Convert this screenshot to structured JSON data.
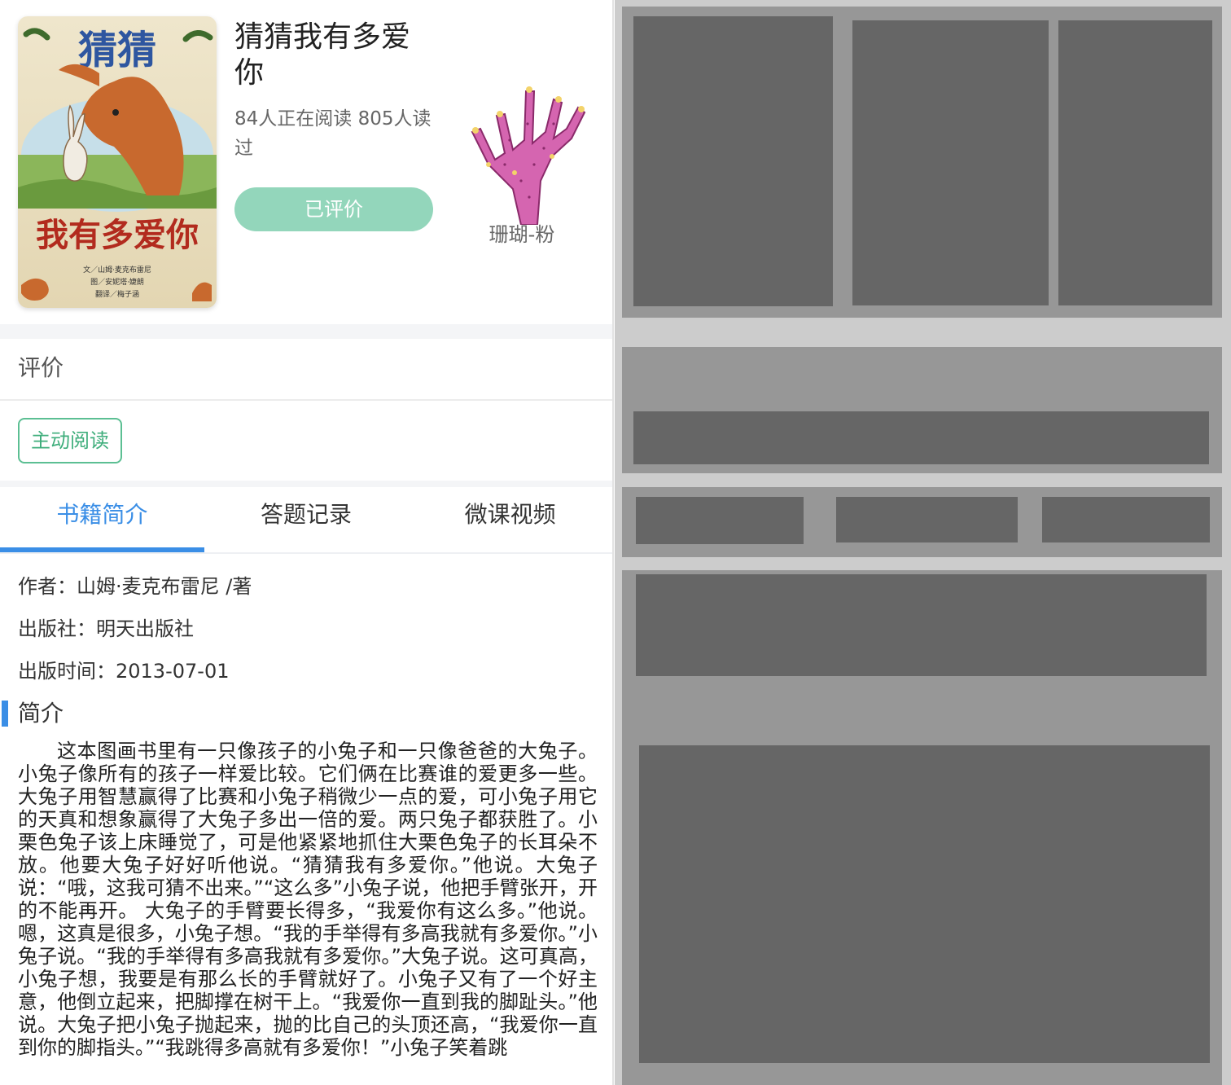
{
  "book": {
    "title": "猜猜我有多爱你",
    "reading_stats": "84人正在阅读 805人读过",
    "rated_button": "已评价",
    "badge_label": "珊瑚-粉",
    "cover": {
      "title_top": "猜猜",
      "title_bottom": "我有多爱你",
      "credits": [
        "文／山姆·麦克布雷尼",
        "图／安妮塔·婕朗",
        "翻译／梅子涵"
      ]
    }
  },
  "evaluation": {
    "title": "评价",
    "tag": "主动阅读"
  },
  "tabs": [
    {
      "label": "书籍简介",
      "active": true
    },
    {
      "label": "答题记录",
      "active": false
    },
    {
      "label": "微课视频",
      "active": false
    }
  ],
  "details": {
    "author_label": "作者：",
    "author": "山姆·麦克布雷尼 /著",
    "publisher_label": "出版社：",
    "publisher": "明天出版社",
    "pubdate_label": "出版时间：",
    "pubdate": "2013-07-01",
    "intro_title": "简介",
    "intro_text": "这本图画书里有一只像孩子的小兔子和一只像爸爸的大兔子。小兔子像所有的孩子一样爱比较。它们俩在比赛谁的爱更多一些。大兔子用智慧赢得了比赛和小兔子稍微少一点的爱，可小兔子用它的天真和想象赢得了大兔子多出一倍的爱。两只兔子都获胜了。小栗色兔子该上床睡觉了，可是他紧紧地抓住大栗色兔子的长耳朵不放。他要大兔子好好听他说。“猜猜我有多爱你。”他说。大兔子说：“哦，这我可猜不出来。”“这么多”小兔子说，他把手臂张开，开的不能再开。 大兔子的手臂要长得多，“我爱你有这么多。”他说。嗯，这真是很多，小兔子想。“我的手举得有多高我就有多爱你。”小兔子说。“我的手举得有多高我就有多爱你。”大兔子说。这可真高，小兔子想，我要是有那么长的手臂就好了。小兔子又有了一个好主意，他倒立起来，把脚撑在树干上。“我爱你一直到我的脚趾头。”他说。大兔子把小兔子抛起来，抛的比自己的头顶还高，“我爱你一直到你的脚指头。”“我跳得多高就有多爱你！”小兔子笑着跳"
  },
  "colors": {
    "accent_blue": "#3a8ee6",
    "accent_green": "#5cbf93",
    "button_green": "#93d6bb",
    "placeholder_dark": "#666666",
    "placeholder_mid": "#979797",
    "placeholder_bg": "#cccccc"
  }
}
